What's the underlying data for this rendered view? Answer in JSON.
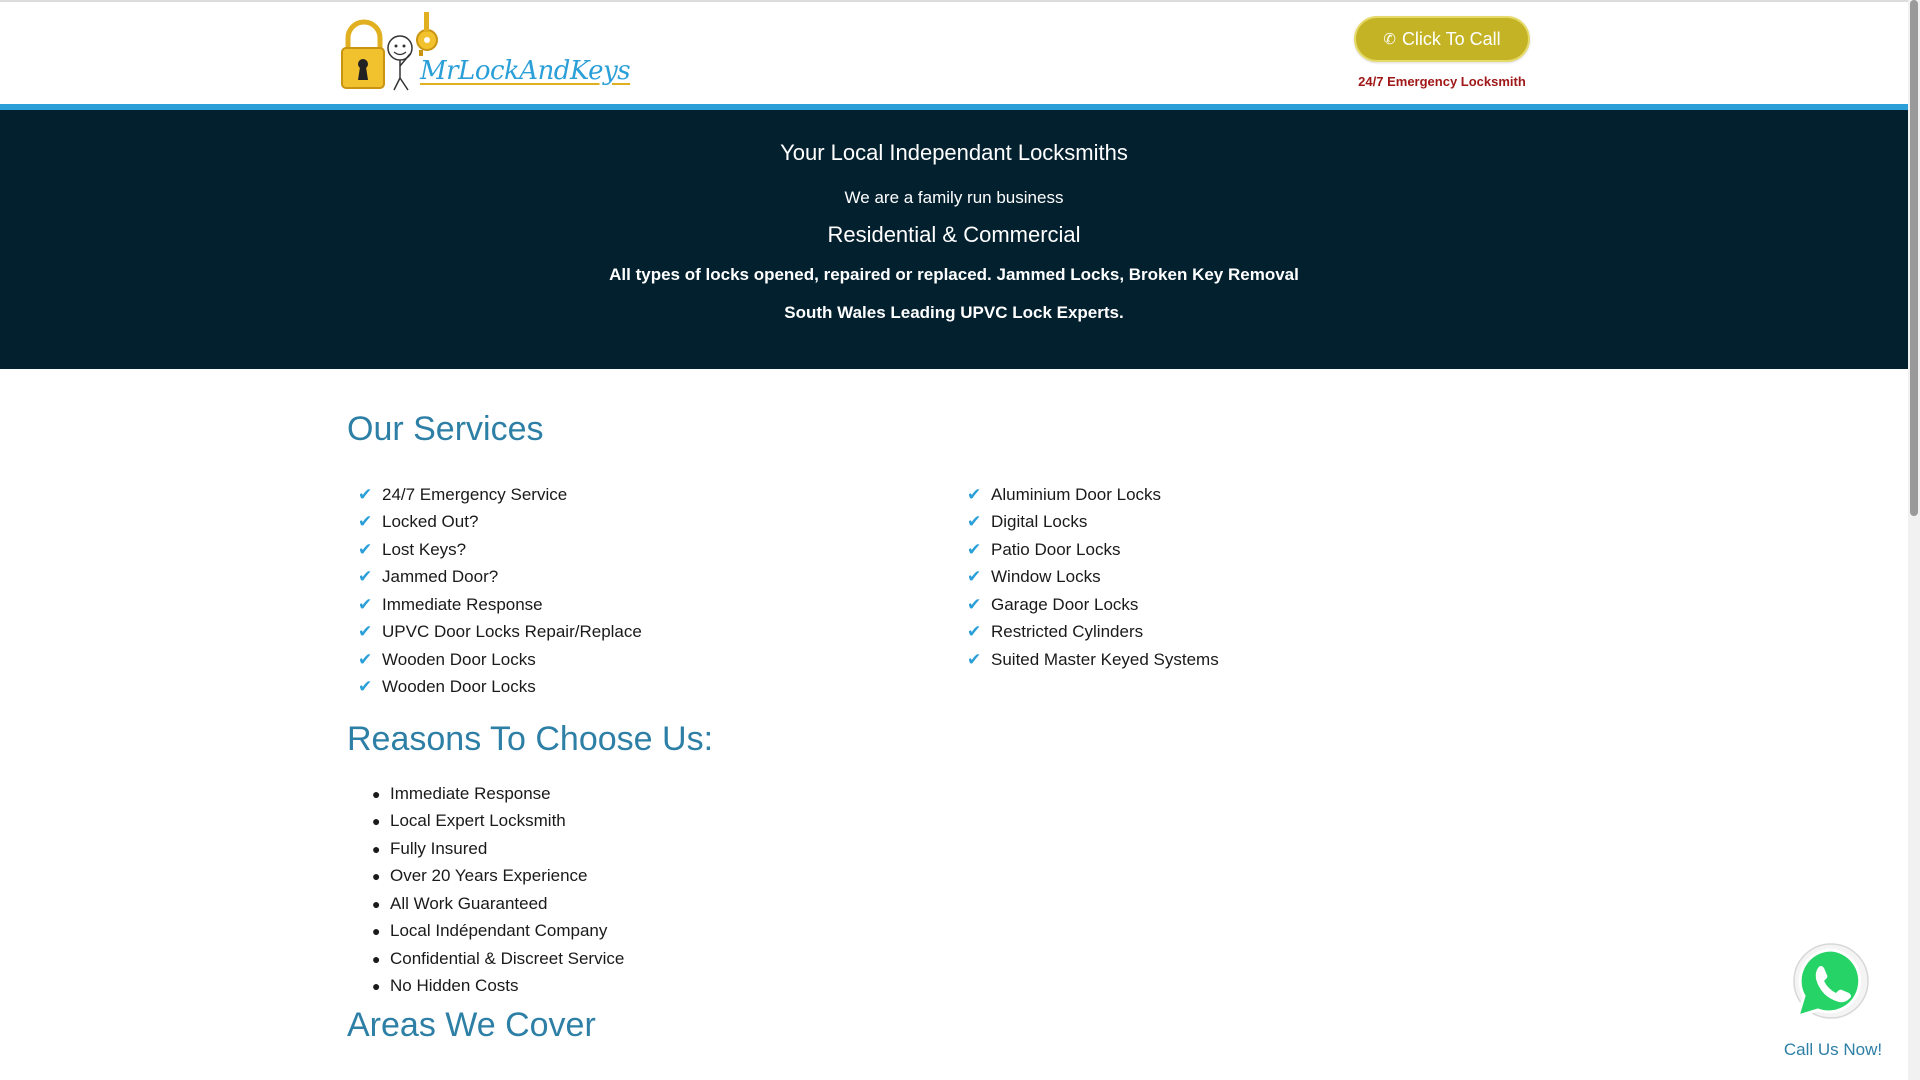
{
  "header": {
    "logo_text": "MrLockAndKeys",
    "call_button_label": "Click To Call",
    "phone_icon": "phone-icon",
    "emergency_text": "24/7 Emergency Locksmith"
  },
  "hero": {
    "title": "Your Local Independant Locksmiths",
    "subtitle": "We are a family run business",
    "heading": "Residential & Commercial",
    "line1": "All types of locks opened, repaired or replaced. Jammed Locks, Broken Key Removal",
    "line2": "South Wales Leading UPVC Lock Experts."
  },
  "services": {
    "heading": "Our Services",
    "left": [
      "24/7 Emergency Service",
      "Locked Out?",
      "Lost Keys?",
      "Jammed Door?",
      "Immediate Response",
      "UPVC Door Locks Repair/Replace",
      "Wooden Door Locks",
      "Wooden Door Locks"
    ],
    "right": [
      "Aluminium Door Locks",
      "Digital Locks",
      "Patio Door Locks",
      "Window Locks",
      "Garage Door Locks",
      "Restricted Cylinders",
      "Suited Master Keyed Systems"
    ]
  },
  "reasons": {
    "heading": "Reasons To Choose Us:",
    "items": [
      "Immediate Response",
      "Local Expert Locksmith",
      "Fully Insured",
      "Over 20 Years Experience",
      "All Work Guaranteed",
      "Local Indépendant Company",
      "Confidential & Discreet Service",
      "No Hidden Costs"
    ]
  },
  "areas": {
    "heading": "Areas We Cover"
  },
  "whatsapp": {
    "label": "Call Us Now!",
    "icon": "whatsapp-icon"
  },
  "colors": {
    "accent_blue": "#2a9fd8",
    "heading_blue": "#2d7fa6",
    "hero_bg": "#03202f",
    "call_button": "#c4b324",
    "emergency_red": "#a01818",
    "whatsapp_green": "#25d366"
  }
}
